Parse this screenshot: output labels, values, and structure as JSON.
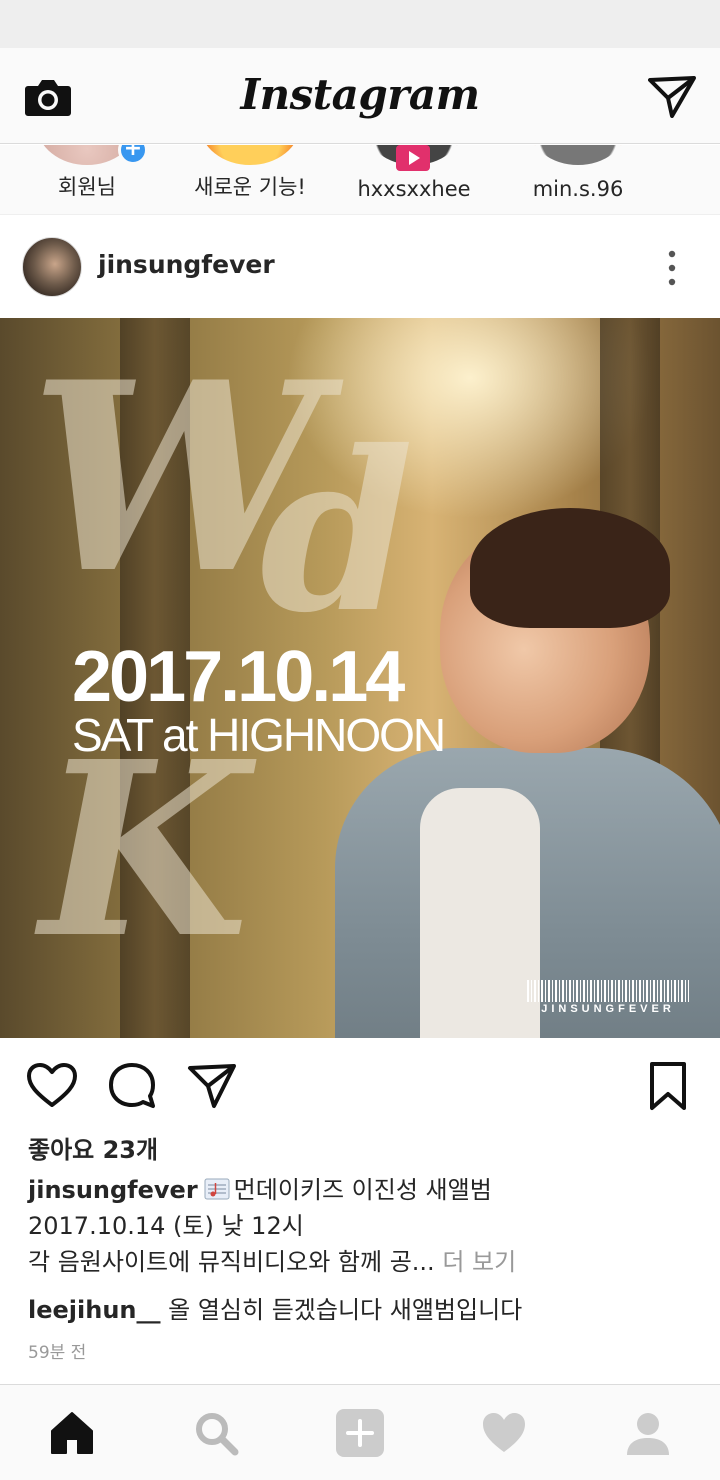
{
  "app": {
    "title": "Instagram"
  },
  "topbar": {
    "camera_icon": "camera-icon",
    "direct_icon": "paper-plane-icon"
  },
  "stories": [
    {
      "label": "회원님",
      "badge": "+"
    },
    {
      "label": "새로운 기능!"
    },
    {
      "label": "hxxsxxhee",
      "badge": "live"
    },
    {
      "label": "min.s.96"
    }
  ],
  "post": {
    "username": "jinsungfever",
    "image": {
      "date_text": "2017.10.14",
      "sub_text": "SAT at HIGHNOON",
      "brand_text": "JINSUNGFEVER"
    },
    "likes": "좋아요 23개",
    "caption": {
      "username": "jinsungfever",
      "line1": "먼데이키즈 이진성 새앨범",
      "line2": "2017.10.14 (토) 낮 12시",
      "line3": "각 음원사이트에 뮤직비디오와 함께 공...",
      "more": "더 보기"
    },
    "comment": {
      "username": "leejihun__",
      "text": "올 열심히 듣겠습니다 새앨범입니다"
    },
    "timestamp": "59분 전"
  },
  "colors": {
    "accent": "#3897f0",
    "live": "#e1306c",
    "text": "#262626",
    "muted": "#999999"
  },
  "tabs": [
    "home-icon",
    "search-icon",
    "add-post-icon",
    "heart-icon",
    "profile-icon"
  ]
}
